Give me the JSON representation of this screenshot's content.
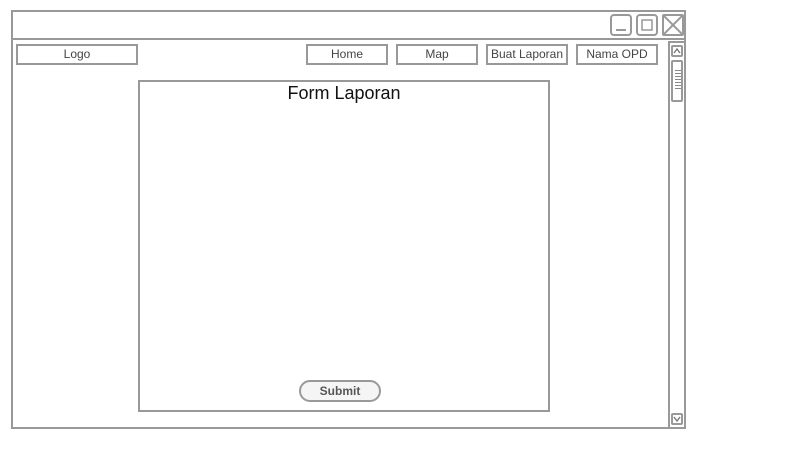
{
  "titlebar": {
    "controls": {
      "minimize_icon": "minimize-icon",
      "maximize_icon": "maximize-icon",
      "close_icon": "close-icon"
    }
  },
  "nav": {
    "logo": "Logo",
    "items": [
      {
        "label": "Home"
      },
      {
        "label": "Map"
      },
      {
        "label": "Buat Laporan"
      },
      {
        "label": "Nama OPD"
      }
    ]
  },
  "form": {
    "title": "Form Laporan",
    "submit_label": "Submit"
  },
  "scrollbar": {
    "up_icon": "chevron-up-icon",
    "down_icon": "chevron-down-icon"
  },
  "colors": {
    "border": "#999999",
    "background": "#ffffff"
  }
}
